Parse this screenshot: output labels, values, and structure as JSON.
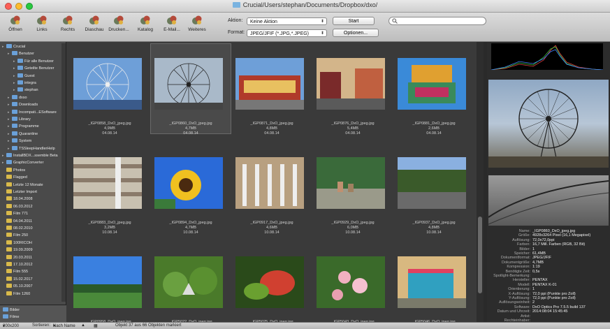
{
  "window": {
    "title": "Crucial/Users/stephan/Documents/Dropbox/dxo/"
  },
  "toolbar": {
    "buttons": [
      {
        "label": "Öffnen",
        "icon": "open-icon"
      },
      {
        "label": "Links",
        "icon": "rotate-left-icon"
      },
      {
        "label": "Rechts",
        "icon": "rotate-right-icon"
      },
      {
        "label": "Diaschau",
        "icon": "slideshow-icon"
      },
      {
        "label": "Drucken...",
        "icon": "print-icon"
      },
      {
        "label": "Katalog",
        "icon": "catalog-icon"
      },
      {
        "label": "E-Mail...",
        "icon": "email-icon"
      },
      {
        "label": "Weiteres",
        "icon": "more-icon"
      }
    ],
    "aktion_label": "Aktion:",
    "aktion_value": "Keine Aktion",
    "start_label": "Start",
    "format_label": "Format:",
    "format_value": "JPEG/JFIF (*.JPG,*.JPEG)",
    "optionen_label": "Optionen...",
    "search_placeholder": ""
  },
  "sidebar": {
    "tree": [
      {
        "label": "Crucial",
        "level": 0,
        "type": "blue"
      },
      {
        "label": "Benutzer",
        "level": 1,
        "type": "blue"
      },
      {
        "label": "Für alle Benutzer",
        "level": 2,
        "type": "blue"
      },
      {
        "label": "Geteilte Benutzer",
        "level": 2,
        "type": "blue"
      },
      {
        "label": "Guest",
        "level": 2,
        "type": "blue"
      },
      {
        "label": "integra",
        "level": 2,
        "type": "blue"
      },
      {
        "label": "stephan",
        "level": 2,
        "type": "blue"
      },
      {
        "label": "dxso",
        "level": 1,
        "type": "blue"
      },
      {
        "label": "Downloads",
        "level": 1,
        "type": "blue"
      },
      {
        "label": "Incompati...ESoftware",
        "level": 1,
        "type": "blue"
      },
      {
        "label": "Library",
        "level": 1,
        "type": "blue"
      },
      {
        "label": "Programme",
        "level": 1,
        "type": "blue"
      },
      {
        "label": "Quarantine",
        "level": 1,
        "type": "blue"
      },
      {
        "label": "System",
        "level": 1,
        "type": "blue"
      },
      {
        "label": "TSSleepHandlerHelp",
        "level": 1,
        "type": "blue"
      },
      {
        "label": "InstallBDX...ssemble Beta",
        "level": 0,
        "type": "blue"
      },
      {
        "label": "GraphicConverter",
        "level": 0,
        "type": "blue"
      },
      {
        "label": "Photos",
        "level": 0,
        "type": "yellow"
      },
      {
        "label": "Flagged",
        "level": 0,
        "type": "yellow"
      },
      {
        "label": "Letzte 12 Monate",
        "level": 0,
        "type": "yellow"
      },
      {
        "label": "Letzter Import",
        "level": 0,
        "type": "yellow"
      },
      {
        "label": "18.04.2008",
        "level": 0,
        "type": "yellow"
      },
      {
        "label": "06.03.2012",
        "level": 0,
        "type": "yellow"
      },
      {
        "label": "Film 771",
        "level": 0,
        "type": "yellow"
      },
      {
        "label": "04.04.2011",
        "level": 0,
        "type": "yellow"
      },
      {
        "label": "08.02.2010",
        "level": 0,
        "type": "yellow"
      },
      {
        "label": "Film 250",
        "level": 0,
        "type": "yellow"
      },
      {
        "label": "100RICOH",
        "level": 0,
        "type": "yellow"
      },
      {
        "label": "19.09.2009",
        "level": 0,
        "type": "yellow"
      },
      {
        "label": "20.03.2011",
        "level": 0,
        "type": "yellow"
      },
      {
        "label": "17.10.2012",
        "level": 0,
        "type": "yellow"
      },
      {
        "label": "Film 555",
        "level": 0,
        "type": "yellow"
      },
      {
        "label": "15.02.2017",
        "level": 0,
        "type": "yellow"
      },
      {
        "label": "05.10.2007",
        "level": 0,
        "type": "yellow"
      },
      {
        "label": "Film 1260",
        "level": 0,
        "type": "yellow"
      }
    ],
    "bottom_items": [
      "Bilder",
      "Filme"
    ]
  },
  "thumbnails": [
    {
      "name": "_IGP0858_DxO_jpeg.jpg",
      "size": "4,9MB",
      "date": "04.08.14",
      "scene": "ferris-day"
    },
    {
      "name": "_IGP0860_DxO_jpeg.jpg",
      "size": "4,7MB",
      "date": "04.08.14",
      "scene": "ferris-dusk",
      "selected": true
    },
    {
      "name": "_IGP0871_DxO_jpeg.jpg",
      "size": "4,8MB",
      "date": "04.08.14",
      "scene": "fair-stall"
    },
    {
      "name": "_IGP0876_DxO_jpeg.jpg",
      "size": "5,4MB",
      "date": "04.08.14",
      "scene": "fair-evening"
    },
    {
      "name": "_IGP0881_DxO_jpeg.jpg",
      "size": "2,6MB",
      "date": "04.08.14",
      "scene": "chocolate"
    },
    {
      "name": "_IGP0883_DxO_jpeg.jpg",
      "size": "3,2MB",
      "date": "10.08.14",
      "scene": "mall"
    },
    {
      "name": "_IGP0894_DxO_jpeg.jpg",
      "size": "4,7MB",
      "date": "10.08.14",
      "scene": "sunflower"
    },
    {
      "name": "_IGP0917_DxO_jpeg.jpg",
      "size": "4,6MB",
      "date": "10.08.14",
      "scene": "colonnade"
    },
    {
      "name": "_IGP0929_DxO_jpeg.jpg",
      "size": "6,0MB",
      "date": "10.08.14",
      "scene": "park-people"
    },
    {
      "name": "_IGP0937_DxO_jpeg.jpg",
      "size": "4,8MB",
      "date": "10.08.14",
      "scene": "park"
    },
    {
      "name": "_IGP0958_DxO_jpeg.jpg",
      "size": "2,9MB",
      "date": "10.08.14",
      "scene": "field"
    },
    {
      "name": "_IGP5022_DxO_jpeg.jpg",
      "size": "6,6MB",
      "date": "07.09.14",
      "scene": "vines"
    },
    {
      "name": "_IGP5025_DxO_jpeg.jpg",
      "size": "5,5MB",
      "date": "07.09.14",
      "scene": "leaves"
    },
    {
      "name": "_IGP5043_DxO_jpeg.jpg",
      "size": "6,0MB",
      "date": "07.09.14",
      "scene": "flowers"
    },
    {
      "name": "_IGP5046_DxO_jpeg.jpg",
      "size": "5,6MB",
      "date": "07.09.14",
      "scene": "kiosk"
    }
  ],
  "metadata": [
    {
      "k": "Name:",
      "v": "_IGP0860_DxO_jpeg.jpg"
    },
    {
      "k": "Größe:",
      "v": "4928x3264 Pixel (16,1 Megapixel)"
    },
    {
      "k": "Auflösung:",
      "v": "72,0x72,0ppi"
    },
    {
      "k": "Farben:",
      "v": "16,7 Mill. Farben (RGB, 32 Bit)"
    },
    {
      "k": "Bilder:",
      "v": "1"
    },
    {
      "k": "Speicher:",
      "v": "61,4MB"
    },
    {
      "k": "Dokumentformat:",
      "v": "JPEG/JFIF"
    },
    {
      "k": "Dokumentgröße:",
      "v": "4,7MB"
    },
    {
      "k": "Kompression:",
      "v": "1:19"
    },
    {
      "k": "Benötigte Zeit:",
      "v": "0,5s"
    },
    {
      "k": "Spotlight-Bemerkung:",
      "v": ""
    },
    {
      "k": "Hersteller:",
      "v": "PENTAX"
    },
    {
      "k": "Modell:",
      "v": "PENTAX K-01"
    },
    {
      "k": "Orientierung:",
      "v": "1"
    },
    {
      "k": "X-Auflösung:",
      "v": "72,0 ppi (Punkte pro Zoll)"
    },
    {
      "k": "Y-Auflösung:",
      "v": "72,0 ppi (Punkte pro Zoll)"
    },
    {
      "k": "Auflösungseinheit:",
      "v": "2"
    },
    {
      "k": "Software:",
      "v": "DxO Optics Pro 7.5.5 build 137"
    },
    {
      "k": "Datum und Uhrzeit:",
      "v": "2014:08:04 15:45:45"
    },
    {
      "k": "Artist:",
      "v": ""
    },
    {
      "k": "Rechteinhaber:",
      "v": ""
    }
  ],
  "status": {
    "zoom": "200x200",
    "sort_label": "Sortieren:",
    "sort_value": "Nach Name",
    "text": "Objekt 37 aus 66 Objekten markiert"
  }
}
